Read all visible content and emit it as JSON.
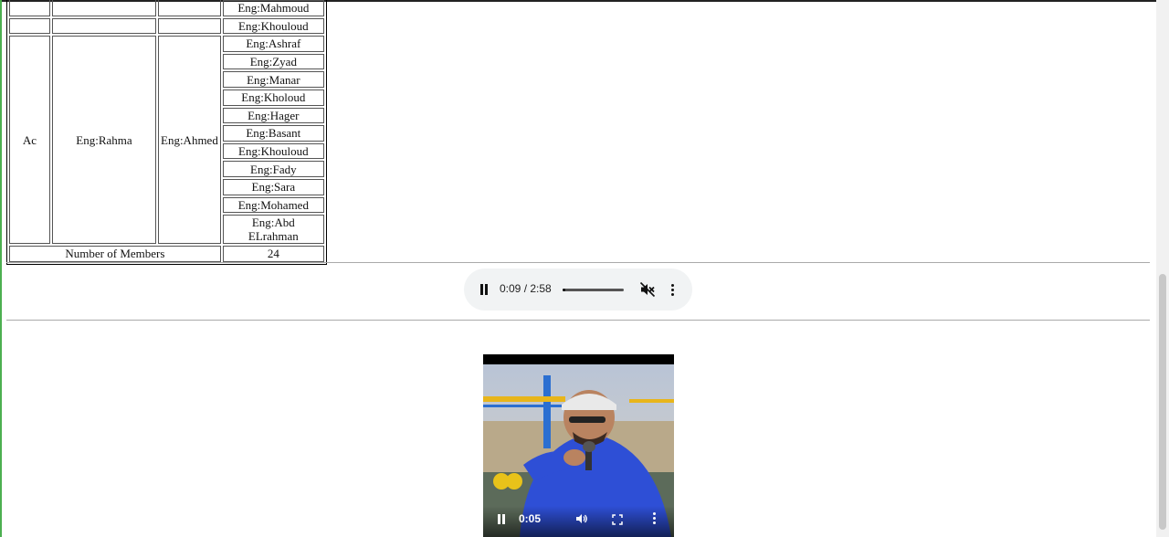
{
  "table": {
    "top_rows": [
      "Eng:Mahmoud",
      "Eng:Khouloud"
    ],
    "group": {
      "team": "Ac",
      "leader": "Eng:Rahma",
      "co_leader": "Eng:Ahmed",
      "members": [
        "Eng:Ashraf",
        "Eng:Zyad",
        "Eng:Manar",
        "Eng:Kholoud",
        "Eng:Hager",
        "Eng:Basant",
        "Eng:Khouloud",
        "Eng:Fady",
        "Eng:Sara",
        "Eng:Mohamed",
        "Eng:Abd ELrahman"
      ]
    },
    "footer": {
      "label": "Number of Members",
      "count": "24"
    }
  },
  "audio": {
    "time": "0:09 / 2:58",
    "progress": 0.05,
    "muted": true
  },
  "video": {
    "time": "0:05"
  },
  "icons": {
    "audio": [
      "pause-icon",
      "mute-icon",
      "more-options-icon"
    ],
    "video": [
      "pause-icon",
      "volume-icon",
      "fullscreen-icon",
      "more-options-icon"
    ]
  },
  "colors": {
    "page_edge": "#4caf50",
    "audio_bg": "#f1f3f4"
  }
}
